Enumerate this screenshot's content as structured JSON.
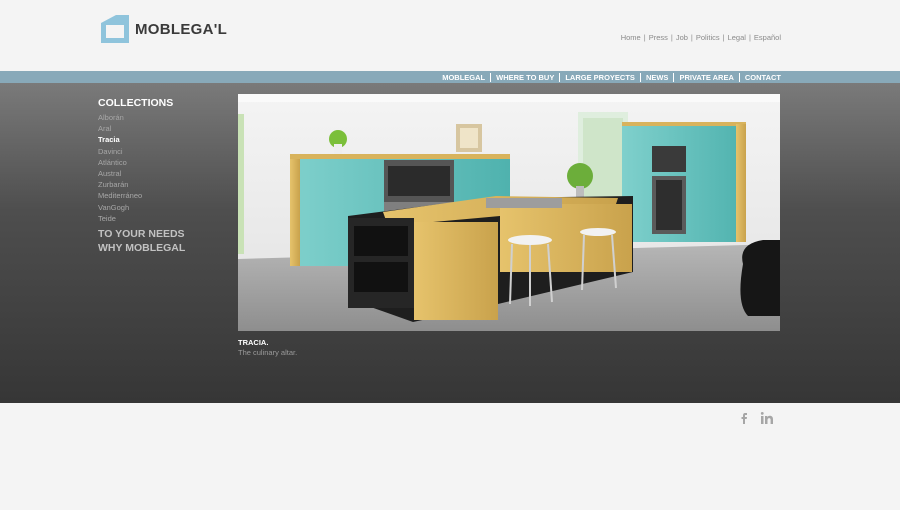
{
  "brand": {
    "name": "MOBLEGA'L",
    "accent": "#88a9b9",
    "logo_color": "#8fc4dc"
  },
  "top_links": [
    "Home",
    "Press",
    "Job",
    "Politics",
    "Legal",
    "Español"
  ],
  "nav": [
    "MOBLEGAL",
    "WHERE TO BUY",
    "LARGE PROYECTS",
    "NEWS",
    "PRIVATE AREA",
    "CONTACT"
  ],
  "sidebar": {
    "heading": "COLLECTIONS",
    "items": [
      "Alborán",
      "Aral",
      "Tracia",
      "Davinci",
      "Atlántico",
      "Austral",
      "Zurbarán",
      "Mediterráneo",
      "VanGogh",
      "Teide"
    ],
    "active_item": "Tracia",
    "links": [
      "TO YOUR NEEDS",
      "WHY MOBLEGAL"
    ]
  },
  "caption": {
    "title": "TRACIA.",
    "subtitle": "The culinary altar."
  },
  "social": [
    "facebook-icon",
    "linkedin-icon"
  ]
}
